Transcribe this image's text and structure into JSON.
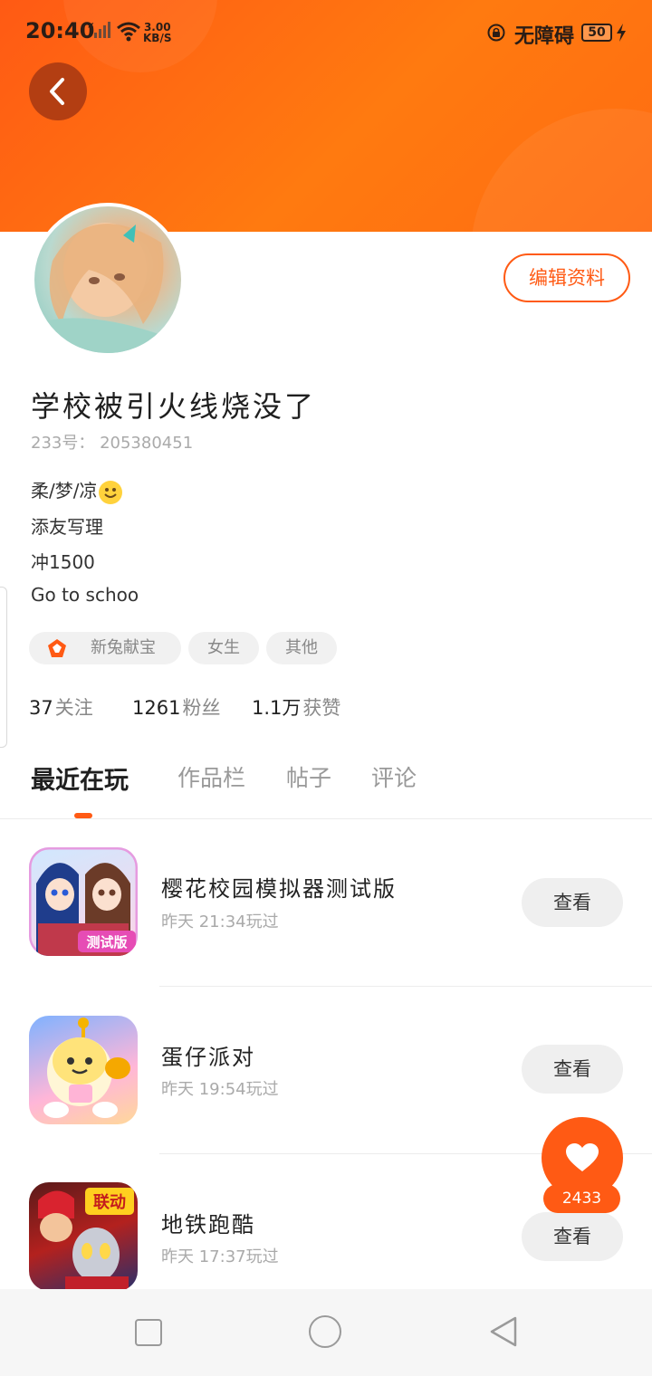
{
  "status_bar": {
    "time": "20:40",
    "network_speed_value": "3.00",
    "network_speed_unit": "KB/S",
    "accessibility": "无障碍",
    "battery": "50"
  },
  "colors": {
    "accent": "#ff5a14",
    "header_gradient": [
      "#ff5a14",
      "#ff7a10"
    ]
  },
  "profile": {
    "username": "学校被引火线烧没了",
    "uid": "233号： 205380451",
    "edit_label": "编辑资料",
    "bio_lines": [
      "柔/梦/凉",
      "添友写理",
      "冲1500",
      "Go to schoo"
    ],
    "tags": [
      {
        "label": "新兔献宝",
        "icon": "badge-icon"
      },
      {
        "label": "女生"
      },
      {
        "label": "其他"
      }
    ],
    "stats": {
      "following_num": "37",
      "following_label": "关注",
      "fans_num": "1261",
      "fans_label": "粉丝",
      "likes_num": "1.1万",
      "likes_label": "获赞"
    }
  },
  "tabs": [
    "最近在玩",
    "作品栏",
    "帖子",
    "评论"
  ],
  "games": [
    {
      "title": "樱花校园模拟器测试版",
      "time": "昨天 21:34玩过",
      "button": "查看",
      "icon_badge": "测试版"
    },
    {
      "title": "蛋仔派对",
      "time": "昨天 19:54玩过",
      "button": "查看"
    },
    {
      "title": "地铁跑酷",
      "time": "昨天 17:37玩过",
      "button": "查看",
      "icon_badge": "联动"
    }
  ],
  "like_fab": {
    "count": "2433"
  }
}
